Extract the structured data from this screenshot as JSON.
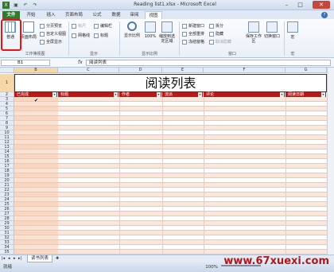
{
  "window": {
    "title": "Reading list1.xlsx - Microsoft Excel",
    "controls": [
      "–",
      "□",
      "✕"
    ]
  },
  "tabs": [
    "文件",
    "开始",
    "插入",
    "页面布局",
    "公式",
    "数据",
    "审阅",
    "视图"
  ],
  "ribbon": {
    "workbook_views": {
      "normal": "普通",
      "page_layout": "页面布局",
      "page_break": "分页预览",
      "custom": "自定义视图",
      "fullscreen": "全屏显示",
      "label": "工作簿视图"
    },
    "show": {
      "ruler": "标尺",
      "formula_bar": "编辑栏",
      "gridlines": "网格线",
      "headings": "标题",
      "label": "显示"
    },
    "zoom": {
      "zoom": "显示比例",
      "hundred": "100%",
      "to_selection": "缩放到选定区域",
      "label": "显示比例"
    },
    "window": {
      "new_window": "新建窗口",
      "arrange_all": "全部重排",
      "freeze": "冻结窗格",
      "split": "拆分",
      "hide": "隐藏",
      "unhide": "取消隐藏",
      "save_workspace": "保存工作区",
      "switch_windows": "切换窗口",
      "label": "窗口"
    },
    "macros": {
      "macros": "宏",
      "label": "宏"
    }
  },
  "formula_bar": {
    "name_box": "B1",
    "fx": "fx",
    "content": "阅读列表"
  },
  "sheet": {
    "columns": [
      "B",
      "C",
      "D",
      "E",
      "F",
      "G"
    ],
    "title": "阅读列表",
    "headers": [
      "已完成",
      "标题",
      "作者",
      "流派",
      "评论",
      "阅读日期"
    ],
    "check_mark": "✔",
    "row_numbers": [
      "1",
      "2",
      "3",
      "4",
      "5",
      "6",
      "7",
      "8",
      "9",
      "10",
      "11",
      "12",
      "13",
      "14",
      "15",
      "16",
      "17",
      "18",
      "19",
      "20",
      "21",
      "22",
      "23",
      "24",
      "25",
      "26",
      "27",
      "28",
      "29",
      "30",
      "31",
      "32",
      "33",
      "34",
      "35"
    ]
  },
  "sheet_tabs": {
    "active": "读书列表"
  },
  "status": {
    "ready": "就绪",
    "zoom": "100%"
  },
  "watermark": "www.67xuexi.com",
  "colors": {
    "header_red": "#b81a1a",
    "file_tab_green": "#2f7a2f",
    "row_alt": "#fbe6dc"
  }
}
